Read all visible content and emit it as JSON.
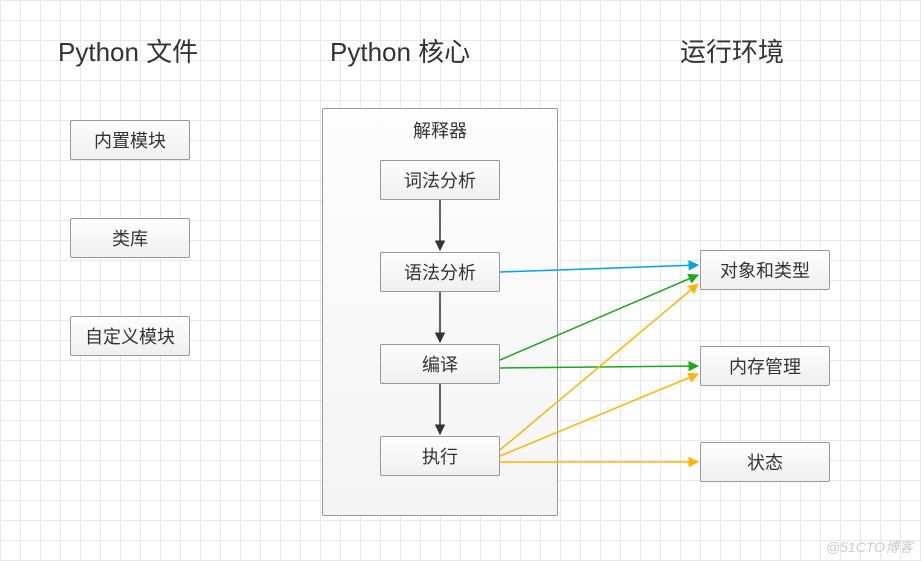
{
  "headings": {
    "col1": "Python 文件",
    "col2": "Python 核心",
    "col3": "运行环境"
  },
  "col1_boxes": {
    "builtin_modules": "内置模块",
    "libs": "类库",
    "custom_modules": "自定义模块"
  },
  "interpreter": {
    "title": "解释器",
    "lexer": "词法分析",
    "parser": "语法分析",
    "compiler": "编译",
    "executor": "执行"
  },
  "col3_boxes": {
    "objects_types": "对象和类型",
    "memory_mgmt": "内存管理",
    "state": "状态"
  },
  "watermark": "@51CTO博客",
  "colors": {
    "blue": "#00a2e8",
    "green": "#1aa91a",
    "orange": "#ffb400",
    "black": "#333333"
  },
  "chart_data": {
    "type": "flow-diagram",
    "columns": [
      {
        "name": "Python 文件",
        "nodes": [
          "内置模块",
          "类库",
          "自定义模块"
        ]
      },
      {
        "name": "Python 核心",
        "container": "解释器",
        "nodes": [
          "词法分析",
          "语法分析",
          "编译",
          "执行"
        ]
      },
      {
        "name": "运行环境",
        "nodes": [
          "对象和类型",
          "内存管理",
          "状态"
        ]
      }
    ],
    "edges": [
      {
        "from": "词法分析",
        "to": "语法分析",
        "color": "black"
      },
      {
        "from": "语法分析",
        "to": "编译",
        "color": "black"
      },
      {
        "from": "编译",
        "to": "执行",
        "color": "black"
      },
      {
        "from": "语法分析",
        "to": "对象和类型",
        "color": "blue"
      },
      {
        "from": "编译",
        "to": "对象和类型",
        "color": "green"
      },
      {
        "from": "编译",
        "to": "内存管理",
        "color": "green"
      },
      {
        "from": "执行",
        "to": "对象和类型",
        "color": "orange"
      },
      {
        "from": "执行",
        "to": "内存管理",
        "color": "orange"
      },
      {
        "from": "执行",
        "to": "状态",
        "color": "orange"
      }
    ]
  }
}
